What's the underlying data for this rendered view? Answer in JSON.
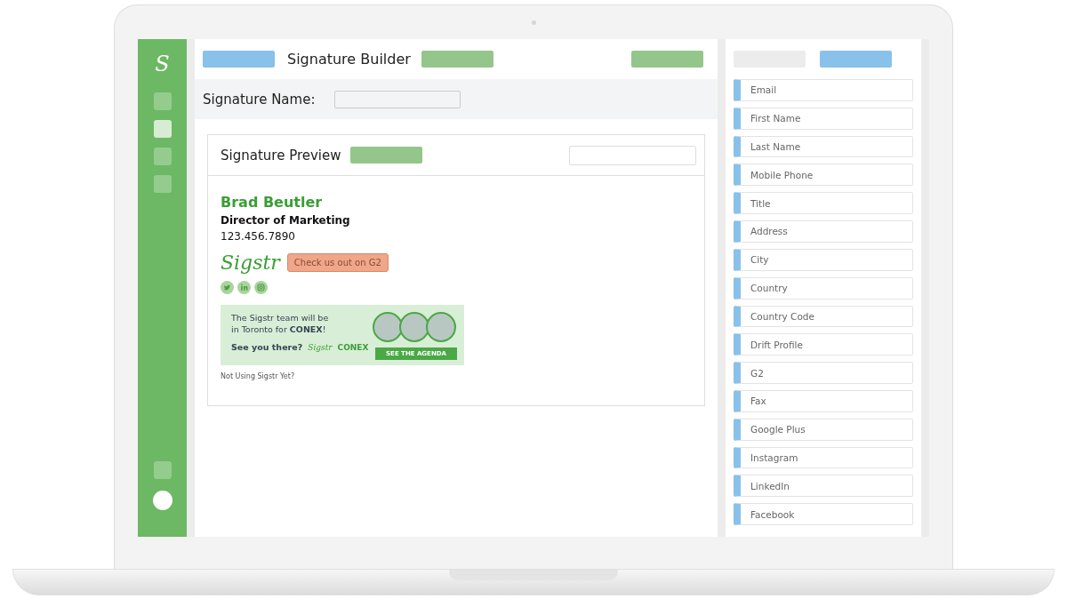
{
  "app_logo": "S",
  "nav_items": [
    {
      "selected": false
    },
    {
      "selected": true
    },
    {
      "selected": false
    },
    {
      "selected": false
    }
  ],
  "header": {
    "title": "Signature Builder"
  },
  "signature_name": {
    "label": "Signature Name:"
  },
  "preview": {
    "title": "Signature Preview",
    "name": "Brad Beutler",
    "job_title": "Director of Marketing",
    "phone": "123.456.7890",
    "logo": "Sigstr",
    "callout": "Check us out on G2",
    "banner": {
      "line_1": "The Sigstr team will be",
      "line_2": "in Toronto for **CONEX**!",
      "question": "See you there?",
      "logo_1": "Sigstr",
      "logo_2": "CONEX",
      "button": "SEE THE AGENDA"
    },
    "footer_link": "Not Using Sigstr Yet?"
  },
  "fields": [
    "Email",
    "First Name",
    "Last Name",
    "Mobile Phone",
    "Title",
    "Address",
    "City",
    "Country",
    "Country Code",
    "Drift Profile",
    "G2",
    "Fax",
    "Google Plus",
    "Instagram",
    "LinkedIn",
    "Facebook"
  ]
}
